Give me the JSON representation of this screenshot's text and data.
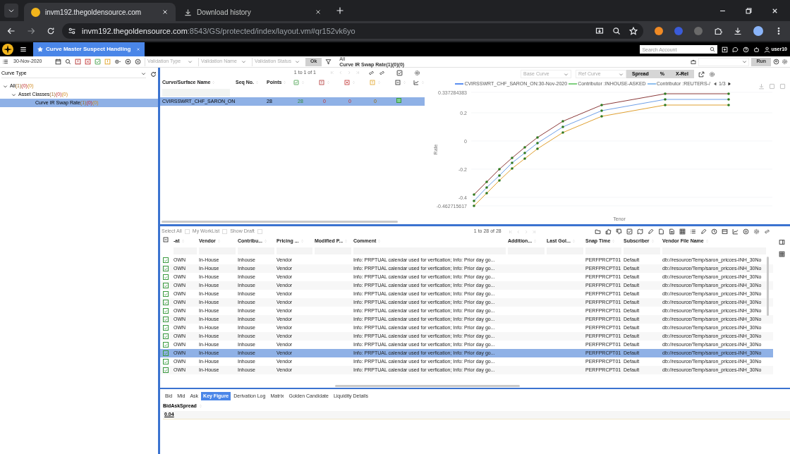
{
  "browser": {
    "tabs": [
      {
        "title": "invm192.thegoldensource.com",
        "kind": "site",
        "selected": true
      },
      {
        "title": "Download history",
        "kind": "download",
        "selected": false
      }
    ],
    "url_host": "invm192.thegoldensource.com",
    "url_path": ":8543/GS/protected/index/layout.vm#qr152vk6yo"
  },
  "app_header": {
    "tab": "Curve Master Suspect Handling",
    "search_placeholder": "Search Account",
    "user": "user10"
  },
  "toolbar": {
    "date": "30-Nov-2020",
    "filters": [
      {
        "placeholder": "Validation Type"
      },
      {
        "placeholder": "Validation Name"
      },
      {
        "placeholder": "Validation Status"
      }
    ],
    "ok": "Ok",
    "scope_1": "All",
    "scope_2": "Curve IR Swap Rate(1)(0)(0)",
    "run": "Run"
  },
  "sidebar": {
    "dropdown": "Curve Type",
    "tree": [
      {
        "label": "All",
        "counts": [
          {
            "text": "(1)",
            "kind": "total"
          },
          {
            "text": "(0)",
            "kind": "error"
          },
          {
            "text": "(0)",
            "kind": "warning"
          }
        ],
        "expanded": true,
        "selected": false,
        "children": [
          {
            "label": "Asset Classes",
            "counts": [
              {
                "text": "(1)",
                "kind": "total"
              },
              {
                "text": "(0)",
                "kind": "error"
              },
              {
                "text": "(0)",
                "kind": "warning"
              }
            ],
            "expanded": true,
            "selected": false,
            "children": [
              {
                "label": "Curve IR Swap Rate",
                "counts": [
                  {
                    "text": "(1)",
                    "kind": "total"
                  },
                  {
                    "text": "(0)",
                    "kind": "error"
                  },
                  {
                    "text": "(0)",
                    "kind": "warning"
                  }
                ],
                "selected": true
              }
            ]
          }
        ]
      }
    ]
  },
  "curve_grid": {
    "pager": "1 to 1 of 1",
    "columns": [
      "Curve/Surface Name",
      "Seq No.",
      "Points"
    ],
    "rows": [
      {
        "name": "CVIRSSWRT_CHF_SARON_ON",
        "seq": "",
        "points": "28",
        "selected": true,
        "counts": [
          {
            "text": "28",
            "kind": "passed"
          },
          {
            "text": "0",
            "kind": "warning"
          },
          {
            "text": "0",
            "kind": "error"
          },
          {
            "text": "0",
            "kind": "info"
          }
        ]
      }
    ]
  },
  "chart": {
    "base_curve": "Base Curve",
    "ref_curve": "Ref Curve",
    "modes": [
      {
        "label": "Spread"
      },
      {
        "label": "%"
      },
      {
        "label": "X-Rel"
      }
    ],
    "legend": [
      {
        "label": "CVIRSSWRT_CHF_SARON_ON:30-Nov-2020",
        "color": "#5b8ff0"
      },
      {
        "label": "Contributor :INHOUSE-ASKED",
        "color": "#7fd07f"
      },
      {
        "label": "Contributor :REUTERS-/",
        "color": "#8fbfef"
      }
    ],
    "legend_page": "1/3",
    "ytick_labels": [
      "0.337284383",
      "0.2",
      "0",
      "-0.2",
      "-0.4",
      "-0.462715617"
    ],
    "xlabel": "Tenor",
    "ylabel": "Rate"
  },
  "points_grid": {
    "links": [
      {
        "label": "Select All",
        "checked": false
      },
      {
        "label": "My WorkList",
        "checked": false
      },
      {
        "label": "Show Draft",
        "checked": false
      }
    ],
    "pager": "1 to 28 of 28",
    "columns": [
      "-at",
      "Vendor",
      "Contribu...",
      "Pricing ...",
      "Modified P...",
      "Comment",
      "Addition...",
      "Last Gol...",
      "Snap Time",
      "Subscriber",
      "Vendor File Name"
    ],
    "rows": [
      {
        "checked": true,
        "selected": false,
        "cells": [
          "OWN",
          "In-House",
          "Inhouse",
          "Vendor",
          "",
          "Info: PRPTUAL calendar used for verfication; Info: Prior day go...",
          "",
          "",
          "PERFPRCPT01",
          "Default",
          "db://resource/Temp/saron_pricces-INH_30No"
        ]
      },
      {
        "checked": true,
        "selected": false,
        "cells": [
          "OWN",
          "In-House",
          "Inhouse",
          "Vendor",
          "",
          "Info: PRPTUAL calendar used for verfication; Info: Prior day go...",
          "",
          "",
          "PERFPRCPT01",
          "Default",
          "db://resource/Temp/saron_pricces-INH_30No"
        ]
      },
      {
        "checked": true,
        "selected": false,
        "cells": [
          "OWN",
          "In-House",
          "Inhouse",
          "Vendor",
          "",
          "Info: PRPTUAL calendar used for verfication; Info: Prior day go...",
          "",
          "",
          "PERFPRCPT01",
          "Default",
          "db://resource/Temp/saron_pricces-INH_30No"
        ]
      },
      {
        "checked": true,
        "selected": false,
        "cells": [
          "OWN",
          "In-House",
          "Inhouse",
          "Vendor",
          "",
          "Info: PRPTUAL calendar used for verfication; Info: Prior day go...",
          "",
          "",
          "PERFPRCPT01",
          "Default",
          "db://resource/Temp/saron_pricces-INH_30No"
        ]
      },
      {
        "checked": true,
        "selected": false,
        "cells": [
          "OWN",
          "In-House",
          "Inhouse",
          "Vendor",
          "",
          "Info: PRPTUAL calendar used for verfication; Info: Prior day go...",
          "",
          "",
          "PERFPRCPT01",
          "Default",
          "db://resource/Temp/saron_pricces-INH_30No"
        ]
      },
      {
        "checked": true,
        "selected": false,
        "cells": [
          "OWN",
          "In-House",
          "Inhouse",
          "Vendor",
          "",
          "Info: PRPTUAL calendar used for verfication; Info: Prior day go...",
          "",
          "",
          "PERFPRCPT01",
          "Default",
          "db://resource/Temp/saron_pricces-INH_30No"
        ]
      },
      {
        "checked": true,
        "selected": false,
        "cells": [
          "OWN",
          "In-House",
          "Inhouse",
          "Vendor",
          "",
          "Info: PRPTUAL calendar used for verfication; Info: Prior day go...",
          "",
          "",
          "PERFPRCPT01",
          "Default",
          "db://resource/Temp/saron_pricces-INH_30No"
        ]
      },
      {
        "checked": true,
        "selected": false,
        "cells": [
          "OWN",
          "In-House",
          "Inhouse",
          "Vendor",
          "",
          "Info: PRPTUAL calendar used for verfication; Info: Prior day go...",
          "",
          "",
          "PERFPRCPT01",
          "Default",
          "db://resource/Temp/saron_pricces-INH_30No"
        ]
      },
      {
        "checked": true,
        "selected": false,
        "cells": [
          "OWN",
          "In-House",
          "Inhouse",
          "Vendor",
          "",
          "Info: PRPTUAL calendar used for verfication; Info: Prior day go...",
          "",
          "",
          "PERFPRCPT01",
          "Default",
          "db://resource/Temp/saron_pricces-INH_30No"
        ]
      },
      {
        "checked": true,
        "selected": false,
        "cells": [
          "OWN",
          "In-House",
          "Inhouse",
          "Vendor",
          "",
          "Info: PRPTUAL calendar used for verfication; Info: Prior day go...",
          "",
          "",
          "PERFPRCPT01",
          "Default",
          "db://resource/Temp/saron_pricces-INH_30No"
        ]
      },
      {
        "checked": true,
        "selected": false,
        "cells": [
          "OWN",
          "In-House",
          "Inhouse",
          "Vendor",
          "",
          "Info: PRPTUAL calendar used for verfication; Info: Prior day go...",
          "",
          "",
          "PERFPRCPT01",
          "Default",
          "db://resource/Temp/saron_pricces-INH_30No"
        ]
      },
      {
        "checked": true,
        "selected": true,
        "cells": [
          "OWN",
          "In-House",
          "Inhouse",
          "Vendor",
          "",
          "Info: PRPTUAL calendar used for verfication; Info: Prior day go...",
          "",
          "",
          "PERFPRCPT01",
          "Default",
          "db://resource/Temp/saron_pricces-INH_30No"
        ]
      },
      {
        "checked": true,
        "selected": false,
        "cells": [
          "OWN",
          "In-House",
          "Inhouse",
          "Vendor",
          "",
          "Info: PRPTUAL calendar used for verfication; Info: Prior day go...",
          "",
          "",
          "PERFPRCPT01",
          "Default",
          "db://resource/Temp/saron_pricces-INH_30No"
        ]
      },
      {
        "checked": true,
        "selected": false,
        "cells": [
          "OWN",
          "In-House",
          "Inhouse",
          "Vendor",
          "",
          "Info: PRPTUAL calendar used for verfication; Info: Prior day go...",
          "",
          "",
          "PERFPRCPT01",
          "Default",
          "db://resource/Temp/saron_pricces-INH_30No"
        ]
      }
    ]
  },
  "detail": {
    "tabs": [
      {
        "label": "Bid",
        "selected": false
      },
      {
        "label": "Mid",
        "selected": false
      },
      {
        "label": "Ask",
        "selected": false
      },
      {
        "label": "Key Figure",
        "selected": true
      },
      {
        "label": "Derivation Log",
        "selected": false
      },
      {
        "label": "Matrix",
        "selected": false
      },
      {
        "label": "Golden Candidate",
        "selected": false
      },
      {
        "label": "Liquidity Details",
        "selected": false
      }
    ],
    "column": "BidAskSpread",
    "value": "0.04"
  }
}
